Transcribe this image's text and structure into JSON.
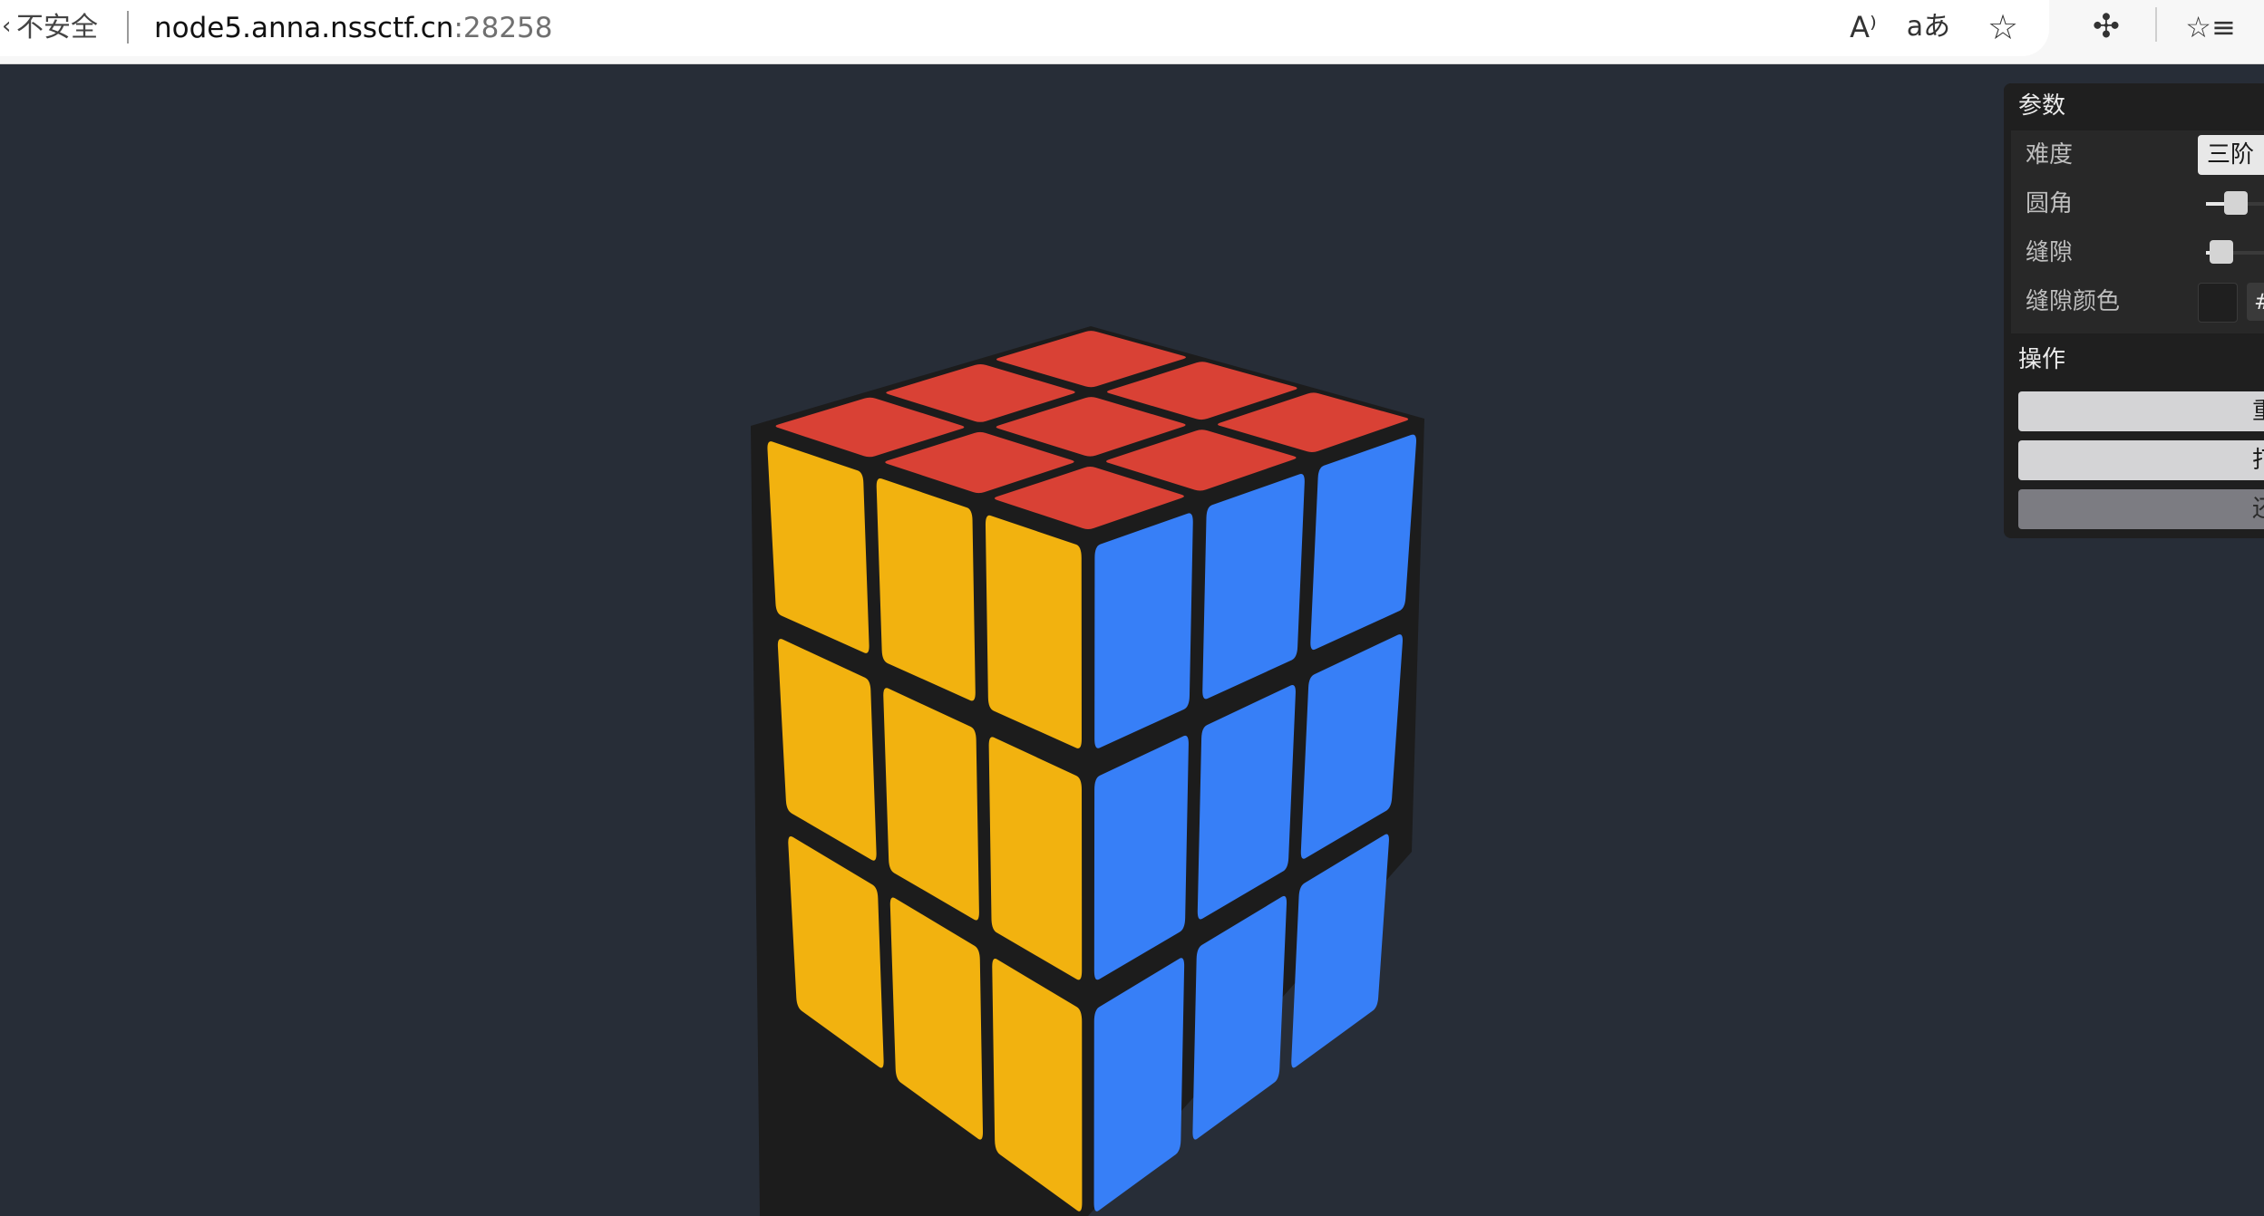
{
  "browser": {
    "security_label": "不安全",
    "url_host": "node5.anna.nssctf.cn",
    "url_port": ":28258",
    "icons": [
      "read-aloud-icon",
      "translate-icon",
      "add-favorite-icon",
      "extensions-icon",
      "favorites-icon"
    ],
    "read_aloud_glyph": "A⁾",
    "translate_glyph": "aあ",
    "favorite_glyph": "☆",
    "extensions_glyph": "✣",
    "favorites_glyph": "☆≡"
  },
  "cube": {
    "order": 3,
    "colors": {
      "top": "#d94135",
      "left": "#f2b20f",
      "right": "#377ff7",
      "gap": "#1c1c1c",
      "background": "#272d37"
    }
  },
  "gui": {
    "params_title": "参数",
    "difficulty_label": "难度",
    "difficulty_value": "三阶",
    "corner_label": "圆角",
    "corner_fraction": 0.3,
    "gap_label": "缝隙",
    "gap_fraction": 0.15,
    "gap_color_label": "缝隙颜色",
    "gap_color_hex": "#",
    "actions_title": "操作",
    "buttons": [
      {
        "label": "重"
      },
      {
        "label": "打"
      },
      {
        "label": "还"
      }
    ]
  }
}
